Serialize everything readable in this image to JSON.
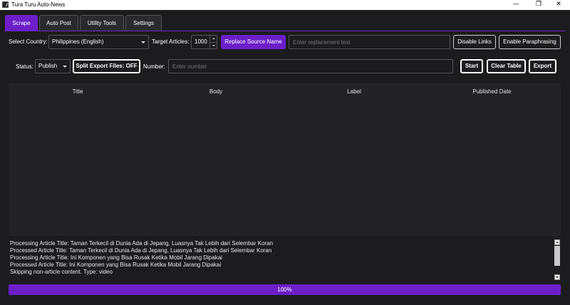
{
  "window": {
    "title": "Tura Turu Auto-News",
    "minimize_glyph": "—",
    "maximize_glyph": "❐",
    "close_glyph": "✕"
  },
  "tabs": [
    {
      "label": "Scrape",
      "active": true
    },
    {
      "label": "Auto Post",
      "active": false
    },
    {
      "label": "Utility Tools",
      "active": false
    },
    {
      "label": "Settings",
      "active": false
    }
  ],
  "row1": {
    "country_label": "Select Country:",
    "country_value": "Philippines (English)",
    "target_label": "Target Articles:",
    "target_value": "1000",
    "replace_button": "Replace Source Name",
    "replacement_placeholder": "Enter replacement text",
    "disable_links_button": "Disable Links",
    "paraphrasing_button": "Enable Paraphrasing"
  },
  "row2": {
    "status_label": "Status:",
    "status_value": "Publish",
    "split_button": "Split Export Files: OFF",
    "number_label": "Number:",
    "number_placeholder": "Enter number",
    "start_button": "Start",
    "clear_button": "Clear Table",
    "export_button": "Export"
  },
  "table": {
    "columns": [
      "Title",
      "Body",
      "Label",
      "Published Date"
    ],
    "rows": []
  },
  "log": [
    "Processing Article Title: Taman Terkecil di Dunia Ada di Jepang, Luasnya Tak Lebih dari Selembar Koran",
    "Processed Article Title: Taman Terkecil di Dunia Ada di Jepang, Luasnya Tak Lebih dari Selembar Koran",
    "Processing Article Title: Ini Komponen yang Bisa Rusak Ketika Mobil Jarang Dipakai",
    "Processed Article Title: Ini Komponen yang Bisa Rusak Ketika Mobil Jarang Dipakai",
    "Skipping non-article content. Type: video"
  ],
  "progress": {
    "value": 100,
    "text": "100%"
  },
  "colors": {
    "accent": "#6c1fc9",
    "background": "#1c1c1e",
    "panel": "#232326"
  }
}
